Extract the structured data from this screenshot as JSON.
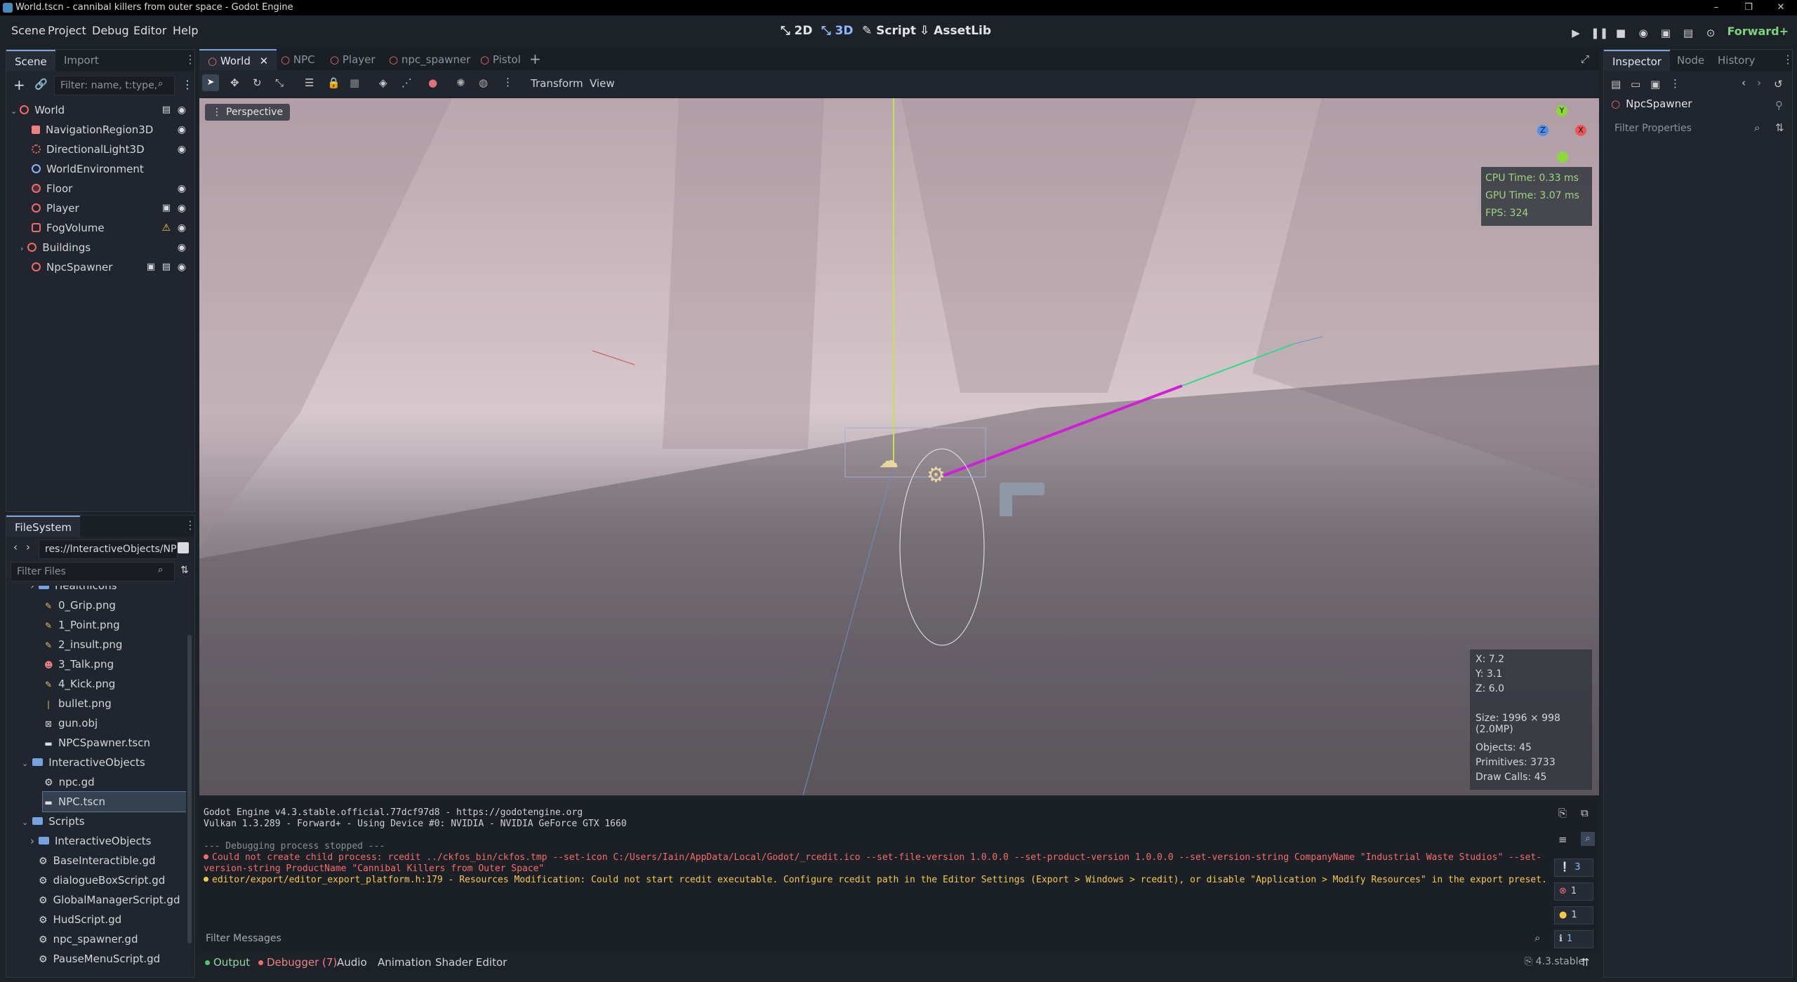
{
  "window": {
    "title": "World.tscn - cannibal killers from outer space - Godot Engine",
    "controls": [
      "–",
      "❐",
      "✕"
    ]
  },
  "menubar": {
    "menus": [
      "Scene",
      "Project",
      "Debug",
      "Editor",
      "Help"
    ],
    "workspaces": [
      "2D",
      "3D",
      "Script",
      "AssetLib"
    ],
    "renderer": "Forward+",
    "accent": "#8fb5ff"
  },
  "scene_dock": {
    "tabs": [
      "Scene",
      "Import"
    ],
    "filter_placeholder": "Filter: name, t:type,",
    "nodes": [
      {
        "label": "World"
      },
      {
        "label": "NavigationRegion3D"
      },
      {
        "label": "DirectionalLight3D"
      },
      {
        "label": "WorldEnvironment"
      },
      {
        "label": "Floor"
      },
      {
        "label": "Player"
      },
      {
        "label": "FogVolume"
      },
      {
        "label": "Buildings"
      },
      {
        "label": "NpcSpawner"
      }
    ]
  },
  "filesystem": {
    "tab": "FileSystem",
    "path": "res://InteractiveObjects/NP",
    "filter_placeholder": "Filter Files",
    "items": [
      "HealthIcons",
      "0_Grip.png",
      "1_Point.png",
      "2_insult.png",
      "3_Talk.png",
      "4_Kick.png",
      "bullet.png",
      "gun.obj",
      "NPCSpawner.tscn",
      "InteractiveObjects",
      "npc.gd",
      "NPC.tscn",
      "Scripts",
      "InteractiveObjects",
      "BaseInteractible.gd",
      "dialogueBoxScript.gd",
      "GlobalManagerScript.gd",
      "HudScript.gd",
      "npc_spawner.gd",
      "PauseMenuScript.gd"
    ]
  },
  "editor": {
    "scene_tabs": [
      "World",
      "NPC",
      "Player",
      "npc_spawner",
      "Pistol"
    ],
    "toolbar_menus": [
      "Transform",
      "View"
    ],
    "viewport_label": "Perspective",
    "gizmo": {
      "y": "Y",
      "x": "X",
      "z": "Z"
    },
    "stats": {
      "cpu": "CPU Time: 0.33 ms",
      "gpu": "GPU Time: 3.07 ms",
      "fps": "FPS: 324"
    },
    "info": {
      "x": "X: 7.2",
      "y": "Y: 3.1",
      "z": "Z: 6.0",
      "size": "Size: 1996 × 998 (2.0MP)",
      "objects": "Objects: 45",
      "primitives": "Primitives: 3733",
      "draw_calls": "Draw Calls: 45"
    }
  },
  "console": {
    "lines": [
      "Godot Engine v4.3.stable.official.77dcf97d8 - https://godotengine.org",
      "Vulkan 1.3.289 - Forward+ - Using Device #0: NVIDIA - NVIDIA GeForce GTX 1660",
      "--- Debugging process stopped ---",
      "Could not create child process: rcedit ../ckfos_bin/ckfos.tmp --set-icon C:/Users/Iain/AppData/Local/Godot/_rcedit.ico --set-file-version 1.0.0.0 --set-product-version 1.0.0.0 --set-version-string CompanyName \"Industrial Waste Studios\" --set-",
      "version-string ProductName \"Cannibal Killers from Outer Space\"",
      "editor/export/editor_export_platform.h:179 - Resources Modification: Could not start rcedit executable. Configure rcedit path in the Editor Settings (Export > Windows > rcedit), or disable \"Application > Modify Resources\" in the export preset."
    ],
    "filter_placeholder": "Filter Messages",
    "counts": [
      "3",
      "1",
      "1",
      "1"
    ],
    "error_color": "#f56c6c",
    "warning_color": "#f7c948"
  },
  "bottom_tabs": [
    "Output",
    "Debugger (7)",
    "Audio",
    "Animation",
    "Shader Editor"
  ],
  "version": "4.3.stable",
  "inspector": {
    "tabs": [
      "Inspector",
      "Node",
      "History"
    ],
    "object": "NpcSpawner",
    "filter_placeholder": "Filter Properties"
  }
}
